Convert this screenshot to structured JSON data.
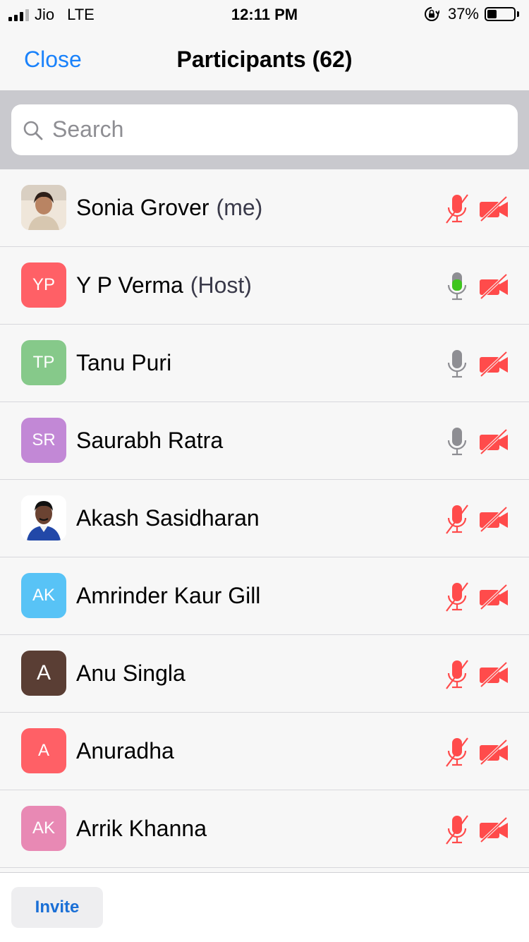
{
  "status_bar": {
    "carrier": "Jio",
    "network": "LTE",
    "time": "12:11 PM",
    "battery_percent_text": "37%",
    "battery_level": 0.37
  },
  "nav": {
    "close_label": "Close",
    "title": "Participants (62)"
  },
  "search": {
    "placeholder": "Search",
    "value": ""
  },
  "participants": [
    {
      "name": "Sonia Grover",
      "role": "(me)",
      "avatar_type": "photo",
      "initials": "",
      "avatar_color": "#e8d8c8",
      "mic": "muted",
      "video": "off"
    },
    {
      "name": "Y P Verma",
      "role": "(Host)",
      "avatar_type": "initials",
      "initials": "YP",
      "avatar_color": "#ff6066",
      "mic": "speaking",
      "video": "off"
    },
    {
      "name": "Tanu Puri",
      "role": "",
      "avatar_type": "initials",
      "initials": "TP",
      "avatar_color": "#86c98a",
      "mic": "on",
      "video": "off"
    },
    {
      "name": "Saurabh Ratra",
      "role": "",
      "avatar_type": "initials",
      "initials": "SR",
      "avatar_color": "#c288d6",
      "mic": "on",
      "video": "off"
    },
    {
      "name": "Akash Sasidharan",
      "role": "",
      "avatar_type": "photo",
      "initials": "",
      "avatar_color": "#ffffff",
      "mic": "muted",
      "video": "off"
    },
    {
      "name": "Amrinder Kaur Gill",
      "role": "",
      "avatar_type": "initials",
      "initials": "AK",
      "avatar_color": "#58c3f6",
      "mic": "muted",
      "video": "off"
    },
    {
      "name": "Anu Singla",
      "role": "",
      "avatar_type": "initials",
      "initials": "A",
      "avatar_color": "#5a3e34",
      "mic": "muted",
      "video": "off"
    },
    {
      "name": "Anuradha",
      "role": "",
      "avatar_type": "initials",
      "initials": "A",
      "avatar_color": "#ff6066",
      "mic": "muted",
      "video": "off"
    },
    {
      "name": "Arrik Khanna",
      "role": "",
      "avatar_type": "initials",
      "initials": "AK",
      "avatar_color": "#e889b4",
      "mic": "muted",
      "video": "off"
    }
  ],
  "footer": {
    "invite_label": "Invite"
  },
  "colors": {
    "accent": "#1a82fb",
    "muted_red": "#ff4b4b",
    "mic_on_gray": "#8e8e93",
    "speaking_green": "#3ec51d"
  },
  "icons": {
    "search": "search-icon",
    "mic_muted": "mic-muted-icon",
    "mic_on": "mic-icon",
    "video_off": "video-off-icon",
    "orientation_lock": "orientation-lock-icon",
    "battery": "battery-icon",
    "signal": "signal-icon"
  }
}
